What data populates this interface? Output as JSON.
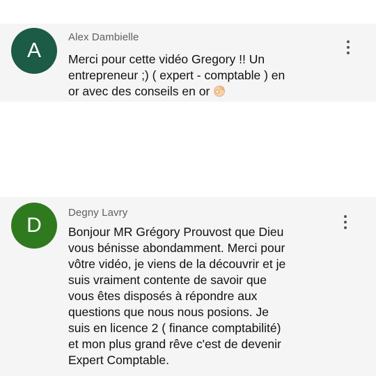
{
  "comments": [
    {
      "avatar_letter": "A",
      "avatar_color": "#1c5b45",
      "author": "Alex Dambielle",
      "text": "Merci pour cette vidéo Gregory !!  Un\nentrepreneur ;) ( expert - comptable ) en\nor avec des conseils en or",
      "emoji": "ok-hand-icon",
      "menu_icon": "more-vert-icon"
    },
    {
      "avatar_letter": "D",
      "avatar_color": "#2f7a1f",
      "author": "Degny Lavry",
      "text": "Bonjour MR Grégory Prouvost que Dieu\nvous bénisse abondamment. Merci pour\nvôtre vidéo, je viens de la découvrir et je\nsuis vraiment contente de savoir que\nvous êtes disposés à répondre aux\nquestions  que nous nous posions. Je\nsuis en licence 2 ( finance comptabilité)\net mon plus grand rêve c'est de devenir\nExpert Comptable.",
      "menu_icon": "more-vert-icon"
    }
  ]
}
